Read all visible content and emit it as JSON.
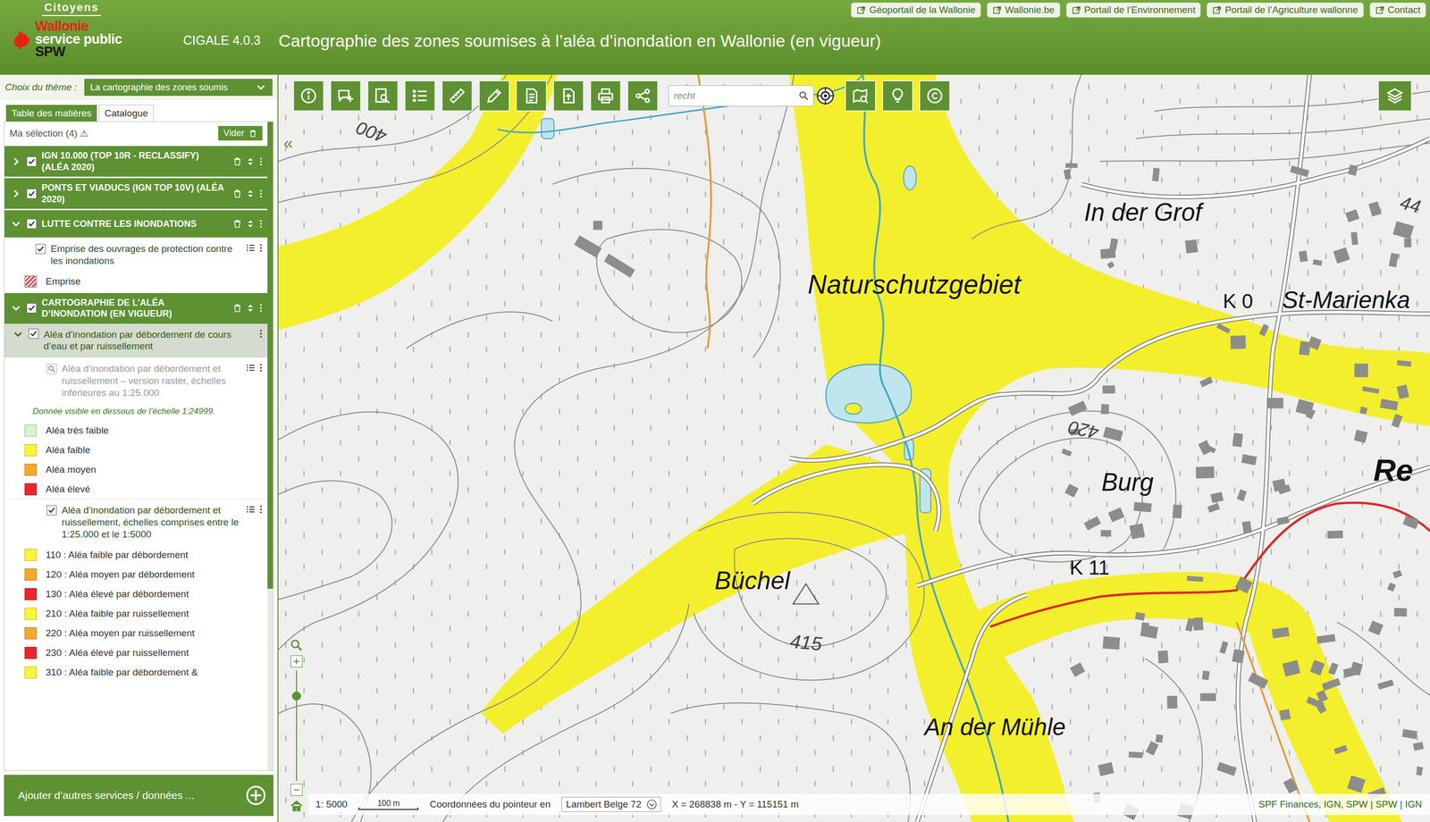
{
  "header": {
    "portal": "Citoyens",
    "logo": {
      "name": "Wallonie",
      "subtitle": "service public",
      "acronym": "SPW"
    },
    "version": "CIGALE 4.0.3",
    "title": "Cartographie des zones soumises à l’aléa d’inondation en Wallonie (en vigueur)",
    "links": [
      "Géoportail de la Wallonie",
      "Wallonie.be",
      "Portail de l’Environnement",
      "Portail de l’Agriculture wallonne",
      "Contact"
    ]
  },
  "sidebar": {
    "theme": {
      "label": "Choix du thème :",
      "value": "La cartographie des zones soumis"
    },
    "tabs": [
      {
        "label": "Table des matières",
        "selected": true
      },
      {
        "label": "Catalogue",
        "selected": false
      }
    ],
    "selection": {
      "label": "Ma sélection (4)",
      "warning": "⚠",
      "clear": "Vider"
    },
    "scrollbar": {
      "level": 0.72
    },
    "groups": [
      {
        "title": "IGN 10.000 (TOP 10R - RECLASSIFY) (ALÉA 2020)",
        "checked": true,
        "expanded": false,
        "entries": []
      },
      {
        "title": "PONTS ET VIADUCS (IGN TOP 10V) (ALÉA 2020)",
        "checked": true,
        "expanded": false,
        "entries": []
      },
      {
        "title": "LUTTE CONTRE LES INONDATIONS",
        "checked": true,
        "expanded": true,
        "entries": [
          {
            "kind": "layer",
            "text": "Emprise des ouvrages de protection contre les inondations",
            "checked": true,
            "disabled": false
          },
          {
            "kind": "legend",
            "text": "Emprise",
            "color": "#e0474c",
            "pattern": "hatch"
          }
        ]
      },
      {
        "title": "CARTOGRAPHIE DE L’ALÉA D’INONDATION (EN VIGUEUR)",
        "checked": true,
        "expanded": true,
        "entries": [
          {
            "kind": "folder",
            "text": "Aléa d’inondation par débordement de cours d’eau et par ruissellement",
            "checked": true,
            "expanded": true
          },
          {
            "kind": "layer",
            "text": "Aléa d’inondation par débordement et ruissellement – version raster, échelles inférieures au 1:25.000",
            "checked": false,
            "disabled": true
          },
          {
            "kind": "note",
            "text": "Donnée visible en dessous de l’échelle 1:24999."
          },
          {
            "kind": "legend",
            "text": "Aléa très faible",
            "color": "#d9f2d0",
            "pattern": "solid"
          },
          {
            "kind": "legend",
            "text": "Aléa faible",
            "color": "#f7f43a",
            "pattern": "solid"
          },
          {
            "kind": "legend",
            "text": "Aléa moyen",
            "color": "#f5a72f",
            "pattern": "solid"
          },
          {
            "kind": "legend",
            "text": "Aléa élevé",
            "color": "#e8262b",
            "pattern": "solid"
          },
          {
            "kind": "layer",
            "text": "Aléa d’inondation par débordement et ruissellement, échelles comprises entre le 1:25.000 et le 1:5000",
            "checked": true,
            "disabled": false
          },
          {
            "kind": "legend",
            "text": "110 : Aléa faible par débordement",
            "color": "#f7f43a",
            "pattern": "solid"
          },
          {
            "kind": "legend",
            "text": "120 : Aléa moyen par débordement",
            "color": "#f5a72f",
            "pattern": "solid"
          },
          {
            "kind": "legend",
            "text": "130 : Aléa élevé par débordement",
            "color": "#e8262b",
            "pattern": "solid"
          },
          {
            "kind": "legend",
            "text": "210 : Aléa faible par ruissellement",
            "color": "#f7f43a",
            "pattern": "solid"
          },
          {
            "kind": "legend",
            "text": "220 : Aléa moyen par ruissellement",
            "color": "#f5a72f",
            "pattern": "solid"
          },
          {
            "kind": "legend",
            "text": "230 : Aléa élevé par ruissellement",
            "color": "#e8262b",
            "pattern": "solid"
          },
          {
            "kind": "legend",
            "text": "310 : Aléa faible par débordement &",
            "color": "#f7f43a",
            "pattern": "solid"
          }
        ]
      }
    ],
    "add_button": "Ajouter d’autres services / données ..."
  },
  "map": {
    "collapse": "«",
    "search": {
      "placeholder": "recht"
    },
    "zoom": {
      "level": 0.77
    },
    "labels": [
      {
        "text": "Naturschutzgebiet",
        "kind": "place"
      },
      {
        "text": "In der Grof",
        "kind": "place"
      },
      {
        "text": "K 0",
        "kind": "road"
      },
      {
        "text": "St-Marienka",
        "kind": "place"
      },
      {
        "text": "Burg",
        "kind": "place"
      },
      {
        "text": "Re",
        "kind": "town"
      },
      {
        "text": "K 11",
        "kind": "road"
      },
      {
        "text": "Büchel",
        "kind": "place"
      },
      {
        "text": "415",
        "kind": "height"
      },
      {
        "text": "An der Mühle",
        "kind": "place"
      },
      {
        "text": "420",
        "kind": "height"
      },
      {
        "text": "400",
        "kind": "height"
      },
      {
        "text": "44",
        "kind": "height"
      }
    ],
    "scale": {
      "ratio": "1: 5000",
      "bar": "100 m"
    },
    "coordinates": {
      "label": "Coordonnées du pointeur en",
      "system": "Lambert Belge 72",
      "value": "X = 268838 m - Y = 115151 m"
    },
    "credits": "SPF Finances, IGN, SPW | SPW | IGN"
  }
}
